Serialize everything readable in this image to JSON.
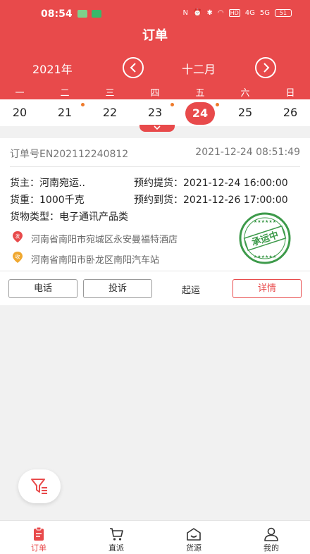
{
  "status_bar": {
    "time": "08:54",
    "battery": "51",
    "hd_label": "HD",
    "net_4g": "4G",
    "net_5g": "5G"
  },
  "header": {
    "title": "订单",
    "year": "2021年",
    "month": "十二月",
    "color": "#e84a4b"
  },
  "calendar": {
    "weekdays": [
      "一",
      "二",
      "三",
      "四",
      "五",
      "六",
      "日"
    ],
    "dates": [
      "20",
      "21",
      "22",
      "23",
      "24",
      "25",
      "26"
    ],
    "selected": "24",
    "dot_days": [
      "21",
      "23",
      "24"
    ],
    "dot_color": "#ee7a2a"
  },
  "order": {
    "order_no": "订单号EN202112240812",
    "created": "2021-12-24 08:51:49",
    "shipper": "货主：河南宛运..",
    "weight": "货重：1000千克",
    "pickup": "预约提货：2021-12-24 16:00:00",
    "arrival": "预约到货：2021-12-26 17:00:00",
    "goods_type": "货物类型：电子通讯产品类",
    "from_badge": "发",
    "from_addr": "河南省南阳市宛城区永安曼福特酒店",
    "to_badge": "收",
    "to_addr": "河南省南阳市卧龙区南阳汽车站",
    "stamp": "承运中",
    "btn_call": "电话",
    "btn_complain": "投诉",
    "btn_start": "起运",
    "btn_detail": "详情"
  },
  "tabbar": {
    "tabs": [
      {
        "label": "订单",
        "icon": "order-icon"
      },
      {
        "label": "直派",
        "icon": "cart-icon"
      },
      {
        "label": "货源",
        "icon": "cargo-box-icon"
      },
      {
        "label": "我的",
        "icon": "user-icon"
      }
    ],
    "active": "订单"
  },
  "fab": {
    "icon": "filter-icon"
  }
}
